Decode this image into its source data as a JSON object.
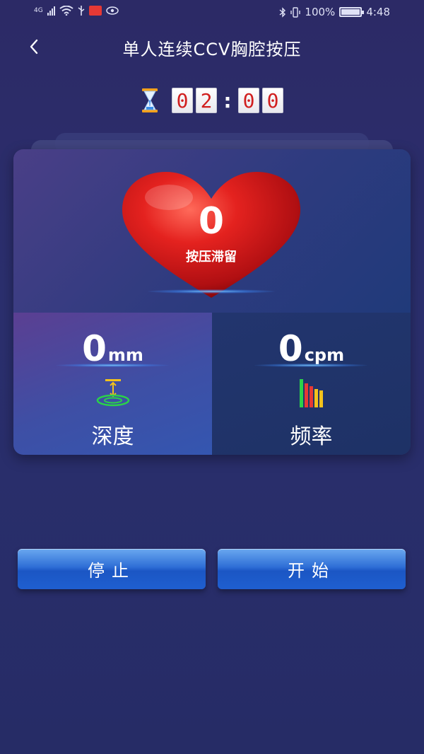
{
  "status_bar": {
    "network": "4G",
    "battery_percent": "100%",
    "time": "4:48"
  },
  "header": {
    "title": "单人连续CCV胸腔按压",
    "back_icon": "chevron-left-icon"
  },
  "timer": {
    "minutes_tens": "0",
    "minutes_ones": "2",
    "separator": ":",
    "seconds_tens": "0",
    "seconds_ones": "0",
    "icon": "hourglass-icon"
  },
  "compression_card": {
    "count": "0",
    "count_label": "按压滞留",
    "depth": {
      "value": "0",
      "unit": "mm",
      "label": "深度",
      "icon": "depth-gauge-icon"
    },
    "rate": {
      "value": "0",
      "unit": "cpm",
      "label": "频率",
      "icon": "bar-chart-icon"
    }
  },
  "buttons": {
    "stop_label": "停止",
    "start_label": "开始"
  },
  "colors": {
    "background": "#2b2f6e",
    "heart": "#d31a1a",
    "timer_digit": "#d11f1f",
    "button": "#1f5fd0"
  }
}
